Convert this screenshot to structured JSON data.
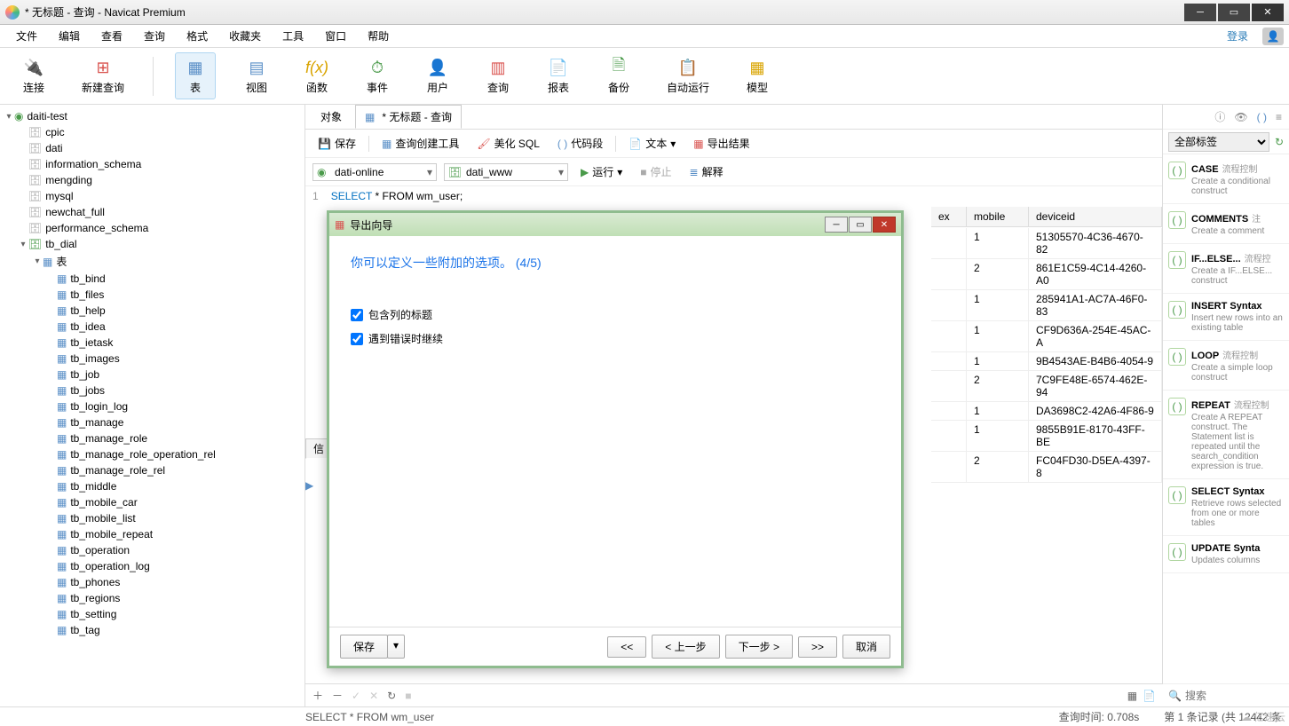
{
  "window": {
    "title": "* 无标题 - 查询 - Navicat Premium"
  },
  "menu": {
    "items": [
      "文件",
      "编辑",
      "查看",
      "查询",
      "格式",
      "收藏夹",
      "工具",
      "窗口",
      "帮助"
    ],
    "login": "登录"
  },
  "toolbar": {
    "connect": "连接",
    "new_query": "新建查询",
    "table": "表",
    "view": "视图",
    "function": "函数",
    "event": "事件",
    "user": "用户",
    "query": "查询",
    "report": "报表",
    "backup": "备份",
    "schedule": "自动运行",
    "model": "模型"
  },
  "sidebar": {
    "connection": "daiti-test",
    "databases": [
      "cpic",
      "dati",
      "information_schema",
      "mengding",
      "mysql",
      "newchat_full",
      "performance_schema"
    ],
    "active_db": "tb_dial",
    "tables_label": "表",
    "tables": [
      "tb_bind",
      "tb_files",
      "tb_help",
      "tb_idea",
      "tb_ietask",
      "tb_images",
      "tb_job",
      "tb_jobs",
      "tb_login_log",
      "tb_manage",
      "tb_manage_role",
      "tb_manage_role_operation_rel",
      "tb_manage_role_rel",
      "tb_middle",
      "tb_mobile_car",
      "tb_mobile_list",
      "tb_mobile_repeat",
      "tb_operation",
      "tb_operation_log",
      "tb_phones",
      "tb_regions",
      "tb_setting",
      "tb_tag"
    ]
  },
  "tabs": {
    "objects": "对象",
    "query": "* 无标题 - 查询"
  },
  "actions": {
    "save": "保存",
    "builder": "查询创建工具",
    "beautify": "美化 SQL",
    "snippet": "代码段",
    "text": "文本",
    "export": "导出结果"
  },
  "conn": {
    "server": "dati-online",
    "database": "dati_www",
    "run": "运行",
    "stop": "停止",
    "explain": "解释"
  },
  "editor": {
    "line": "1",
    "sql_kw": "SELECT",
    "sql_rest": " * FROM wm_user;"
  },
  "info_tab": "信",
  "grid": {
    "cols": [
      "ex",
      "mobile",
      "deviceid"
    ],
    "rows": [
      {
        "mobile": "1",
        "deviceid": "51305570-4C36-4670-82"
      },
      {
        "mobile": "2",
        "deviceid": "861E1C59-4C14-4260-A0"
      },
      {
        "mobile": "1",
        "deviceid": "285941A1-AC7A-46F0-83"
      },
      {
        "mobile": "1",
        "deviceid": "CF9D636A-254E-45AC-A"
      },
      {
        "mobile": "1",
        "deviceid": "9B4543AE-B4B6-4054-9"
      },
      {
        "mobile": "2",
        "deviceid": "7C9FE48E-6574-462E-94"
      },
      {
        "mobile": "1",
        "deviceid": "DA3698C2-42A6-4F86-9"
      },
      {
        "mobile": "1",
        "deviceid": "9855B91E-8170-43FF-BE"
      },
      {
        "mobile": "2",
        "deviceid": "FC04FD30-D5EA-4397-8"
      }
    ]
  },
  "dialog": {
    "title": "导出向导",
    "heading": "你可以定义一些附加的选项。 (4/5)",
    "chk_headers": "包含列的标题",
    "chk_continue": "遇到错误时继续",
    "save": "保存",
    "first": "<<",
    "prev": "< 上一步",
    "next": "下一步 >",
    "last": ">>",
    "cancel": "取消"
  },
  "right": {
    "tag_filter": "全部标签",
    "search_placeholder": "搜索",
    "snippets": [
      {
        "title": "CASE",
        "tag": "流程控制",
        "desc": "Create a conditional construct"
      },
      {
        "title": "COMMENTS",
        "tag": "注",
        "desc": "Create a comment"
      },
      {
        "title": "IF...ELSE...",
        "tag": "流程控",
        "desc": "Create a IF...ELSE... construct"
      },
      {
        "title": "INSERT Syntax",
        "tag": "",
        "desc": "Insert new rows into an existing table"
      },
      {
        "title": "LOOP",
        "tag": "流程控制",
        "desc": "Create a simple loop construct"
      },
      {
        "title": "REPEAT",
        "tag": "流程控制",
        "desc": "Create A REPEAT construct. The Statement list is repeated until the search_condition expression is true."
      },
      {
        "title": "SELECT Syntax",
        "tag": "",
        "desc": "Retrieve rows selected from one or more tables"
      },
      {
        "title": "UPDATE Synta",
        "tag": "",
        "desc": "Updates columns"
      }
    ]
  },
  "status": {
    "sql": "SELECT * FROM wm_user",
    "time_label": "查询时间: ",
    "time": "0.708s",
    "record": "第 1 条记录 (共 12442 条"
  },
  "watermark": "亿速云"
}
